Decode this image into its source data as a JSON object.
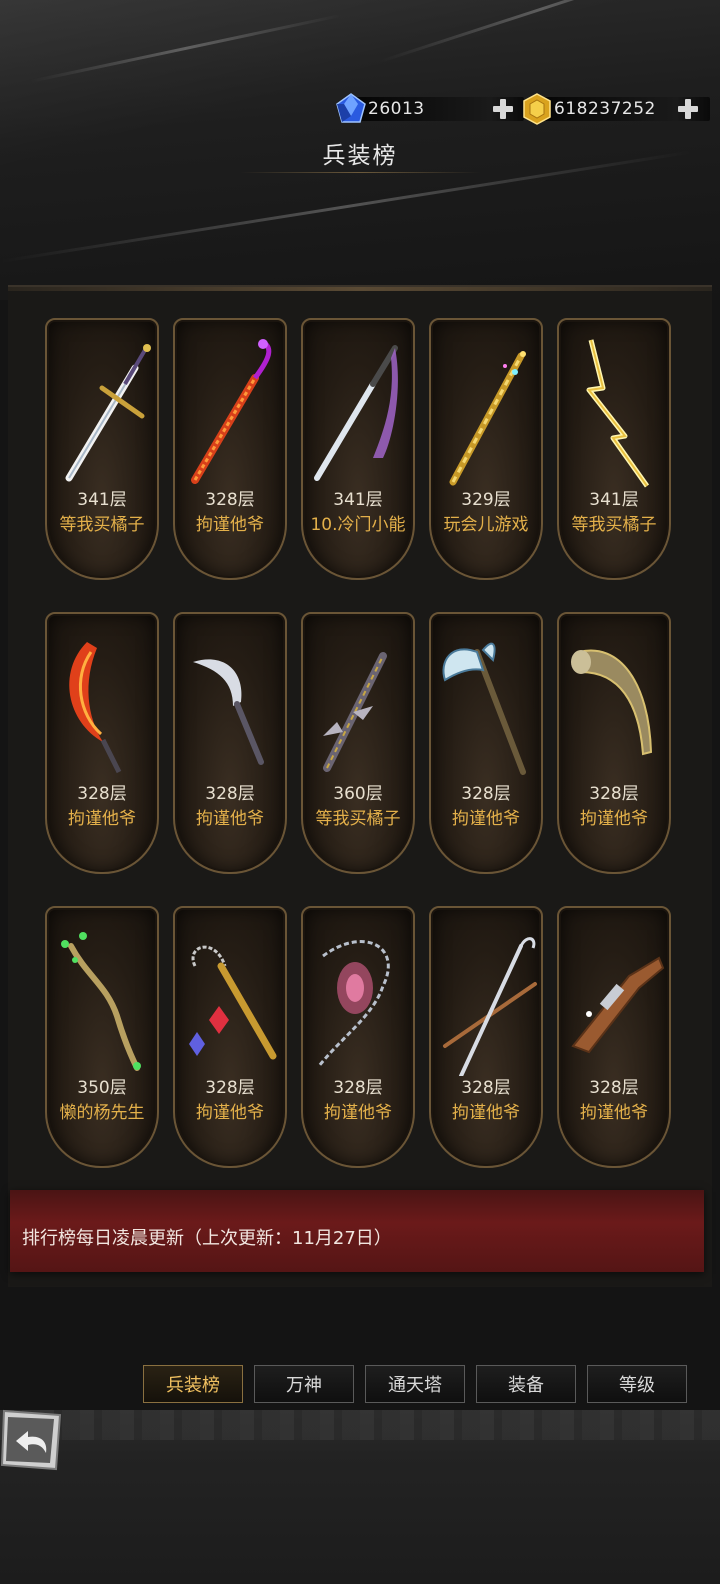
{
  "currency": {
    "gems": "26013",
    "gold": "618237252"
  },
  "title": "兵装榜",
  "weapons": [
    {
      "floor": "341层",
      "owner": "等我买橘子",
      "icon": "ornate-longsword-icon"
    },
    {
      "floor": "328层",
      "owner": "拘谨他爷",
      "icon": "flame-serrated-blade-icon"
    },
    {
      "floor": "341层",
      "owner": "10.冷门小能",
      "icon": "katana-with-ribbon-icon"
    },
    {
      "floor": "329层",
      "owner": "玩会儿游戏",
      "icon": "golden-spiral-staff-icon"
    },
    {
      "floor": "341层",
      "owner": "等我买橘子",
      "icon": "lightning-bolt-icon"
    },
    {
      "floor": "328层",
      "owner": "拘谨他爷",
      "icon": "fire-crescent-blade-icon"
    },
    {
      "floor": "328层",
      "owner": "拘谨他爷",
      "icon": "curved-dagger-icon"
    },
    {
      "floor": "360层",
      "owner": "等我买橘子",
      "icon": "scorpion-blade-icon"
    },
    {
      "floor": "328层",
      "owner": "拘谨他爷",
      "icon": "battle-axe-icon"
    },
    {
      "floor": "328层",
      "owner": "拘谨他爷",
      "icon": "war-horn-icon"
    },
    {
      "floor": "350层",
      "owner": "懒的杨先生",
      "icon": "nature-branch-staff-icon"
    },
    {
      "floor": "328层",
      "owner": "拘谨他爷",
      "icon": "chain-flail-icon"
    },
    {
      "floor": "328层",
      "owner": "拘谨他爷",
      "icon": "chained-crystal-icon"
    },
    {
      "floor": "328层",
      "owner": "拘谨他爷",
      "icon": "crossed-needles-icon"
    },
    {
      "floor": "328层",
      "owner": "拘谨他爷",
      "icon": "flintlock-pistol-icon"
    }
  ],
  "footer": {
    "notice": "排行榜每日凌晨更新（上次更新：11月27日）"
  },
  "tabs": [
    {
      "label": "兵装榜",
      "active": true
    },
    {
      "label": "万神",
      "active": false
    },
    {
      "label": "通天塔",
      "active": false
    },
    {
      "label": "装备",
      "active": false
    },
    {
      "label": "等级",
      "active": false
    }
  ]
}
